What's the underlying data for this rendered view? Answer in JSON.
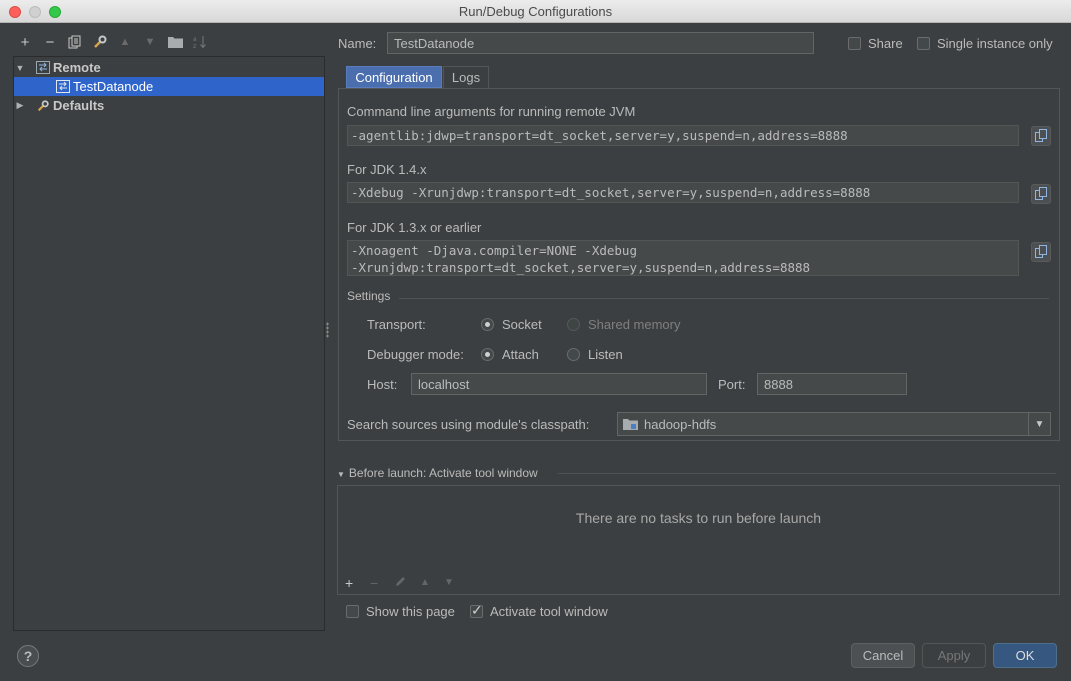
{
  "window": {
    "title": "Run/Debug Configurations"
  },
  "left_toolbar": {
    "icons": [
      "add-icon",
      "remove-icon",
      "copy-icon",
      "wrench-icon",
      "move-up-icon",
      "move-down-icon",
      "folder-icon",
      "sort-icon"
    ]
  },
  "tree": {
    "items": [
      {
        "label": "Remote",
        "expanded": true
      },
      {
        "label": "TestDatanode",
        "selected": true
      },
      {
        "label": "Defaults",
        "expanded": false
      }
    ]
  },
  "header": {
    "name_label": "Name:",
    "name_value": "TestDatanode",
    "share_label": "Share",
    "single_instance_label": "Single instance only"
  },
  "tabs": [
    {
      "label": "Configuration",
      "active": true
    },
    {
      "label": "Logs",
      "active": false
    }
  ],
  "config": {
    "cmd_label": "Command line arguments for running remote JVM",
    "cmd_value": "-agentlib:jdwp=transport=dt_socket,server=y,suspend=n,address=8888",
    "jdk14_label": "For JDK 1.4.x",
    "jdk14_value": "-Xdebug -Xrunjdwp:transport=dt_socket,server=y,suspend=n,address=8888",
    "jdk13_label": "For JDK 1.3.x or earlier",
    "jdk13_line1": "-Xnoagent -Djava.compiler=NONE -Xdebug",
    "jdk13_line2": "-Xrunjdwp:transport=dt_socket,server=y,suspend=n,address=8888",
    "settings_label": "Settings",
    "transport_label": "Transport:",
    "transport_socket": "Socket",
    "transport_shared": "Shared memory",
    "debugger_mode_label": "Debugger mode:",
    "mode_attach": "Attach",
    "mode_listen": "Listen",
    "host_label": "Host:",
    "host_value": "localhost",
    "port_label": "Port:",
    "port_value": "8888",
    "classpath_label": "Search sources using module's classpath:",
    "classpath_value": "hadoop-hdfs"
  },
  "before_launch": {
    "title": "Before launch: Activate tool window",
    "empty_text": "There are no tasks to run before launch",
    "show_page_label": "Show this page",
    "activate_tool_label": "Activate tool window"
  },
  "buttons": {
    "cancel": "Cancel",
    "apply": "Apply",
    "ok": "OK",
    "help": "?"
  },
  "colors": {
    "background": "#3c3f41",
    "selection": "#2f65ca",
    "tab_active": "#4b6eaf",
    "ok_button": "#365880"
  }
}
